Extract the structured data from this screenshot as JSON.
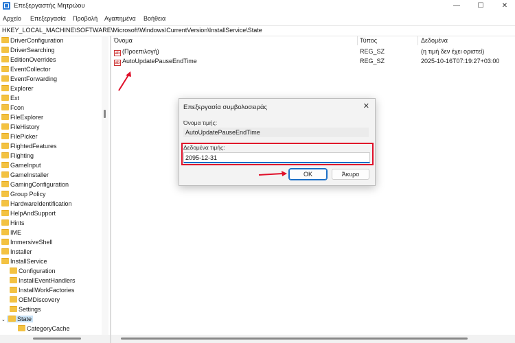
{
  "window": {
    "title": "Επεξεργαστής Μητρώου",
    "minimize": "—",
    "maximize": "☐",
    "close": "✕"
  },
  "menu": [
    "Αρχείο",
    "Επεξεργασία",
    "Προβολή",
    "Αγαπημένα",
    "Βοήθεια"
  ],
  "address": "HKEY_LOCAL_MACHINE\\SOFTWARE\\Microsoft\\Windows\\CurrentVersion\\InstallService\\State",
  "tree": [
    "DriverConfiguration",
    "DriverSearching",
    "EditionOverrides",
    "EventCollector",
    "EventForwarding",
    "Explorer",
    "Ext",
    "Fcon",
    "FileExplorer",
    "FileHistory",
    "FilePicker",
    "FlightedFeatures",
    "Flighting",
    "GameInput",
    "GameInstaller",
    "GamingConfiguration",
    "Group Policy",
    "HardwareIdentification",
    "HelpAndSupport",
    "Hints",
    "IME",
    "ImmersiveShell",
    "Installer",
    "InstallService"
  ],
  "tree_children": [
    "Configuration",
    "InstallEventHandlers",
    "InstallWorkFactories",
    "OEMDiscovery",
    "Settings",
    "State"
  ],
  "tree_grandchild": "CategoryCache",
  "columns": {
    "name": "Όνομα",
    "type": "Τύπος",
    "data": "Δεδομένα"
  },
  "values": [
    {
      "name": "(Προεπιλογή)",
      "type": "REG_SZ",
      "data": "(η τιμή δεν έχει οριστεί)"
    },
    {
      "name": "AutoUpdatePauseEndTime",
      "type": "REG_SZ",
      "data": "2025-10-16T07:19:27+03:00"
    }
  ],
  "value_icon_text": "ab",
  "dialog": {
    "title": "Επεξεργασία συμβολοσειράς",
    "close": "✕",
    "name_label": "Όνομα τιμής:",
    "name_value": "AutoUpdatePauseEndTime",
    "data_label": "Δεδομένα τιμής:",
    "data_value": "2095-12-31",
    "ok": "OK",
    "cancel": "Άκυρο"
  },
  "colors": {
    "annotation": "#e0102a",
    "accent": "#1a6fc7",
    "folder": "#f3c242"
  }
}
